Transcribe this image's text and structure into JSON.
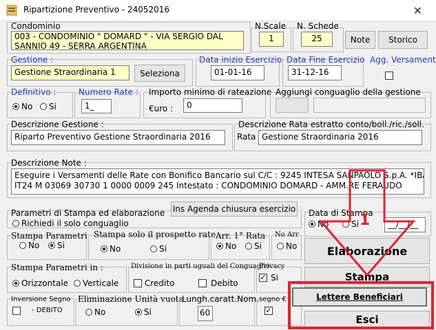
{
  "window": {
    "title": "Ripartizione Preventivo  -  24052016",
    "close_glyph": "✕"
  },
  "condominio": {
    "label": "Condominio",
    "value_line1": "003 - CONDOMINIO \" DOMARD \" - VIA SERGIO DAL",
    "value_line2": "SANNIO 49 - SERRA ARGENTINA"
  },
  "nscale": {
    "label": "N.Scale",
    "value": "1"
  },
  "nschede": {
    "label": "N. Schede",
    "value": "25"
  },
  "buttons": {
    "note": "Note",
    "storico": "Storico",
    "seleziona": "Seleziona",
    "ins_agenda": "Ins Agenda chiusura esercizio",
    "elaborazione": "Elaborazione",
    "stampa": "Stampa",
    "lettere": "Lettere Beneficiari",
    "esci": "Esci"
  },
  "gestione": {
    "label": "Gestione :",
    "value": "Gestione Straordinaria 1"
  },
  "data_inizio": {
    "label": "Data inizio Esercizio",
    "value": "01-01-16"
  },
  "data_fine": {
    "label": "Data Fine Esercizio",
    "value": "31-12-16"
  },
  "agg_versamenti": {
    "label": "Agg. Versamenti"
  },
  "definitivo": {
    "label": "Definitivo :",
    "no": "No",
    "si": "Si",
    "selected": "No"
  },
  "numero_rate": {
    "label": "Numero Rate :",
    "value": "1_"
  },
  "importo_minimo": {
    "label": "Importo minimo di rateazione",
    "currency": "€uro :",
    "value": "0"
  },
  "conguaglio": {
    "label": "Aggiungi conguaglio della gestione"
  },
  "descr_gestione": {
    "label": "Descrizione Gestione :",
    "value": "Riparto Preventivo Gestione Straordinaria 2016"
  },
  "descr_rata": {
    "label": "Descrizione Rata estratto conto/boll./ric./soll.",
    "prefix": "Rata",
    "value": "Gestione Straordinaria 2016"
  },
  "descr_note": {
    "label": "Descrizione Note :",
    "line1": "Eseguire i Versamenti delle Rate con Bonifico Bancario sul C/C : 9245 INTESA SANPAOLO S.p.A. *IBAN",
    "line2": "IT24 M 03069 30730 1 0000 0009 245 Intestato : CONDOMINIO DOMARD - AMM.RE FERAUDO"
  },
  "parametri": {
    "label": "Parametri di Stampa ed elaborazione",
    "solo_conguaglio": "Richiedi il solo conguaglio"
  },
  "data_stampa": {
    "label": "Data di Stampa",
    "no": "No",
    "si": "Si",
    "date": "__/__/__"
  },
  "stampa_parametri": {
    "label": "Stampa Parametri",
    "no": "No",
    "si": "Si"
  },
  "stampa_prospetto": {
    "label": "Stampa solo il prospetto rate",
    "no": "No",
    "si": "Si"
  },
  "arr_rata": {
    "label": "Arr. 1° Rata",
    "no": "No",
    "si": "Si"
  },
  "no_arr": {
    "label": "No Arr",
    "no": "No"
  },
  "stampa_param_in": {
    "label": "Stampa Parametri in :",
    "orizzontale": "Orizzontale",
    "verticale": "Verticale"
  },
  "divisione": {
    "label": "Divisione in parti uguali del Conguaglio",
    "credito": "Credito",
    "debito": "Debito"
  },
  "privacy": {
    "label": "Privacy",
    "si": "Si"
  },
  "inversione": {
    "label": "Inversione Segno",
    "debito": "- DEBITO"
  },
  "eliminazione": {
    "label": "Eliminazione Unità vuote",
    "no": "No",
    "si": "Si"
  },
  "lungh": {
    "label": "Lungh.caratt.Nom.",
    "value": "60"
  },
  "segno": {
    "label": "segno €"
  },
  "annotation": {
    "number": "1",
    "color": "#e8202a"
  }
}
